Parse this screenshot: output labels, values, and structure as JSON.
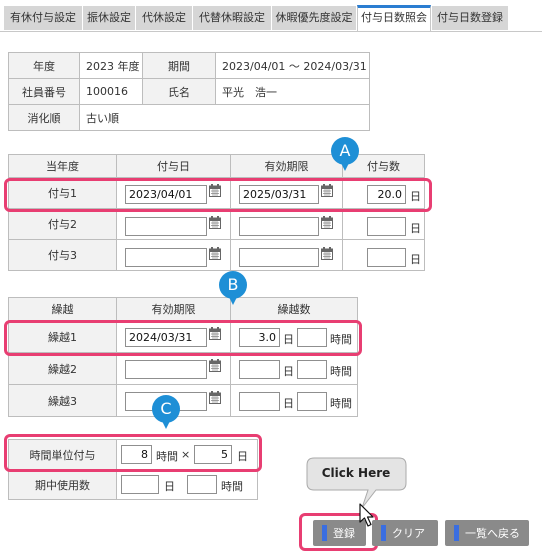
{
  "tabs": [
    {
      "label": "有休付与設定",
      "active": false
    },
    {
      "label": "振休設定",
      "active": false
    },
    {
      "label": "代休設定",
      "active": false
    },
    {
      "label": "代替休暇設定",
      "active": false
    },
    {
      "label": "休暇優先度設定",
      "active": false
    },
    {
      "label": "付与日数照会",
      "active": true
    },
    {
      "label": "付与日数登録",
      "active": false
    }
  ],
  "info": {
    "fiscal_year_label": "年度",
    "fiscal_year_value": "2023 年度",
    "period_label": "期間",
    "period_value": "2023/04/01 ～ 2024/03/31",
    "employee_no_label": "社員番号",
    "employee_no_value": "100016",
    "name_label": "氏名",
    "name_value": "平光　浩一",
    "consume_order_label": "消化順",
    "consume_order_value": "古い順"
  },
  "grant": {
    "headers": [
      "当年度",
      "付与日",
      "有効期限",
      "付与数"
    ],
    "day_unit": "日",
    "rows": [
      {
        "label": "付与1",
        "grant_date": "2023/04/01",
        "expiry": "2025/03/31",
        "days": "20.0"
      },
      {
        "label": "付与2",
        "grant_date": "",
        "expiry": "",
        "days": ""
      },
      {
        "label": "付与3",
        "grant_date": "",
        "expiry": "",
        "days": ""
      }
    ]
  },
  "carry": {
    "headers": [
      "繰越",
      "有効期限",
      "繰越数"
    ],
    "day_unit": "日",
    "hour_unit": "時間",
    "rows": [
      {
        "label": "繰越1",
        "expiry": "2024/03/31",
        "days": "3.0",
        "hours": ""
      },
      {
        "label": "繰越2",
        "expiry": "",
        "days": "",
        "hours": ""
      },
      {
        "label": "繰越3",
        "expiry": "",
        "days": "",
        "hours": ""
      }
    ]
  },
  "hourly": {
    "label": "時間単位付与",
    "hours": "8",
    "hours_unit": "時間",
    "times": "×",
    "days": "5",
    "days_unit": "日",
    "used_label": "期中使用数",
    "used_days": "",
    "used_days_unit": "日",
    "used_hours": "",
    "used_hours_unit": "時間"
  },
  "callouts": {
    "a": "A",
    "b": "B",
    "c": "C",
    "tooltip": "Click Here"
  },
  "buttons": {
    "register": "登録",
    "clear": "クリア",
    "back": "一覧へ戻る"
  },
  "colors": {
    "highlight": "#e83e72",
    "pin": "#1e8fd6",
    "tab_accent": "#2a7dd1",
    "button": "#8a8a8a"
  }
}
